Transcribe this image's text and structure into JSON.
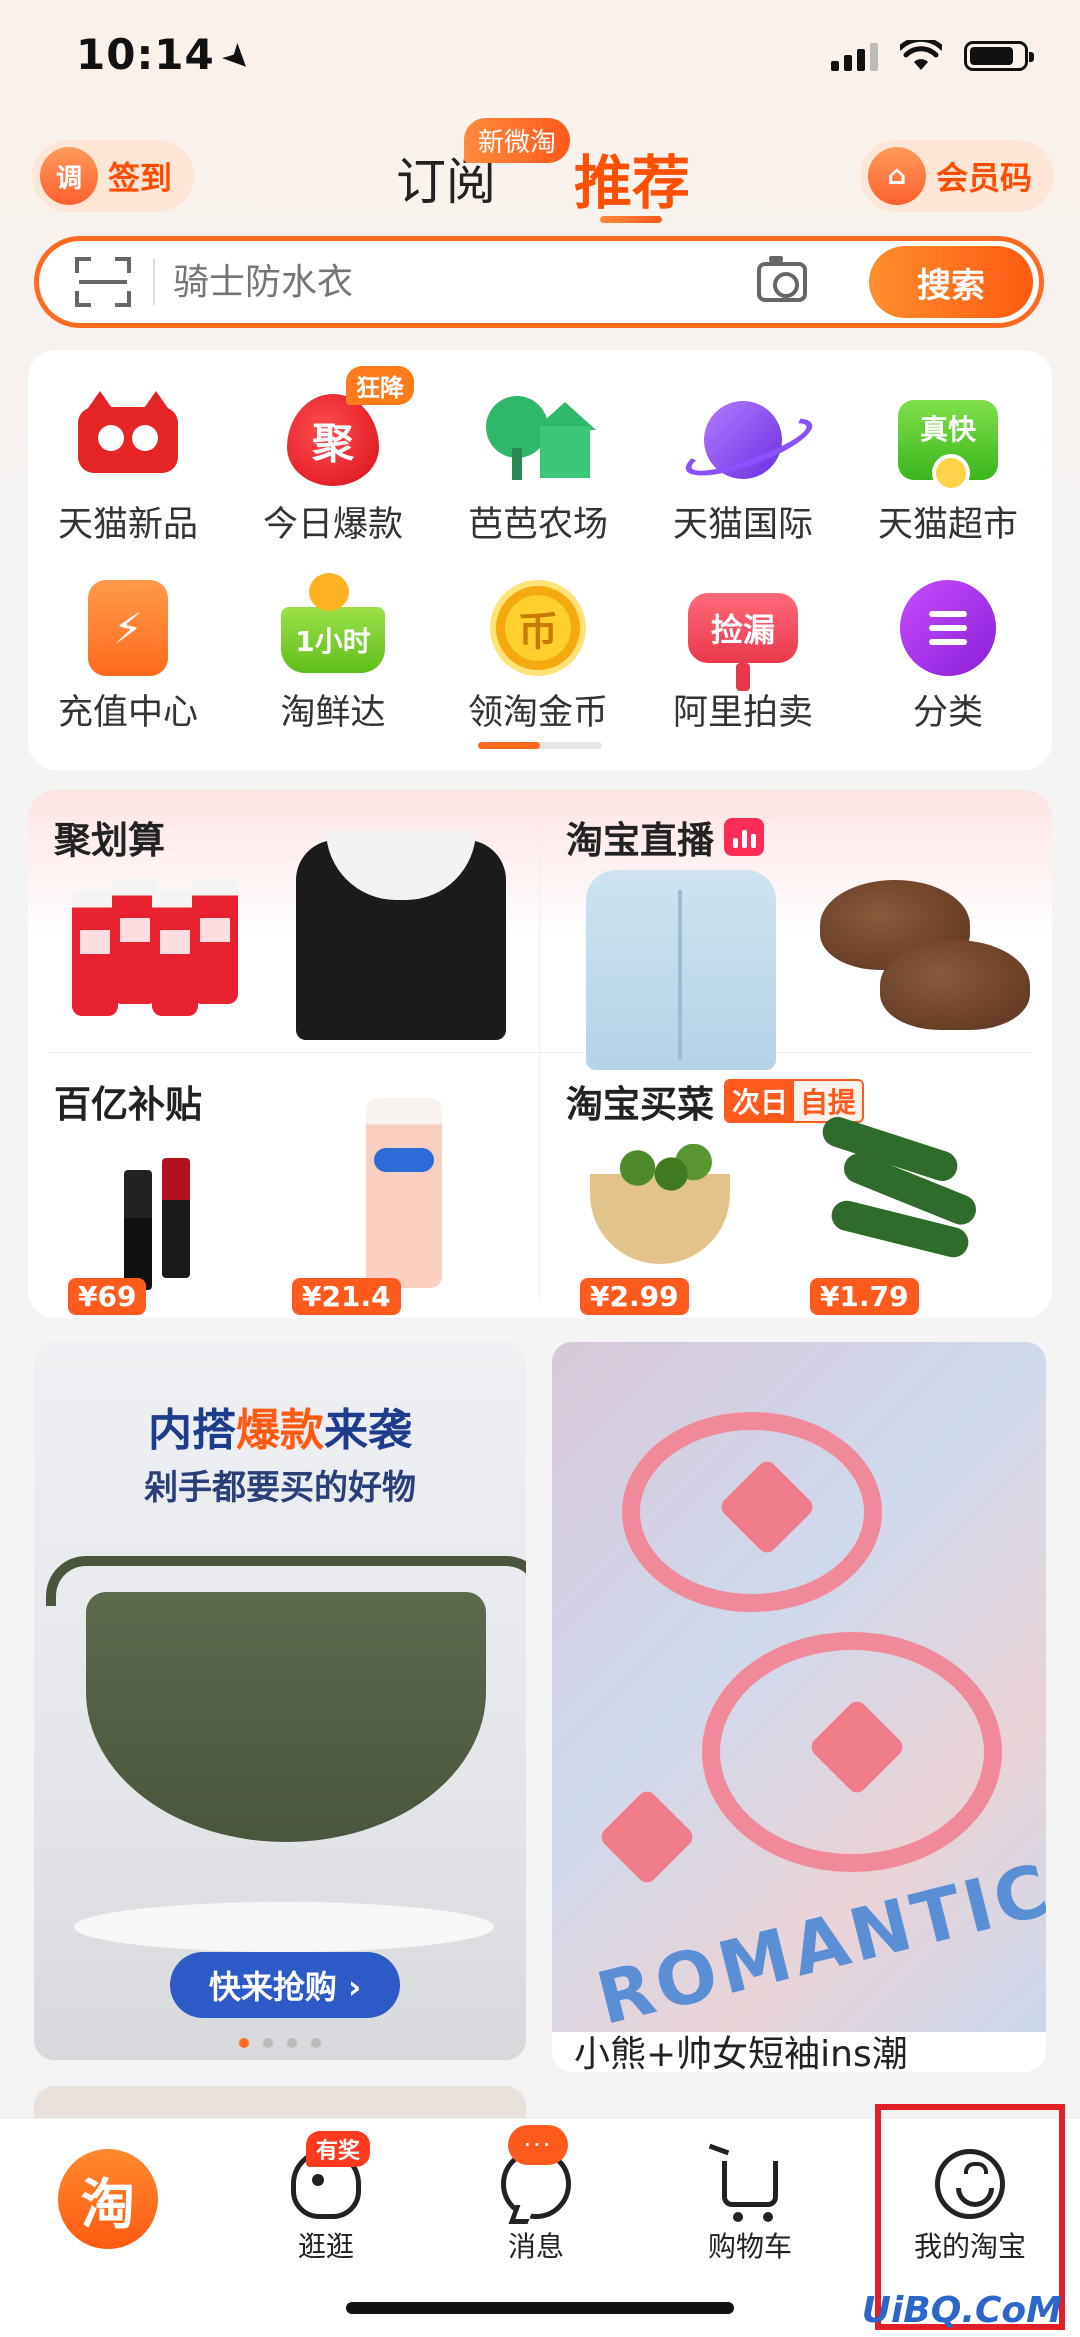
{
  "status": {
    "time": "10:14"
  },
  "header": {
    "checkin_label": "签到",
    "checkin_icon_text": "调",
    "tab_subscribe": "订阅",
    "tab_subscribe_badge": "新微淘",
    "tab_recommend": "推荐",
    "member_label": "会员码"
  },
  "search": {
    "placeholder": "骑士防水衣",
    "button": "搜索"
  },
  "categories": [
    {
      "label": "天猫新品",
      "icon": "tmall-new-icon"
    },
    {
      "label": "今日爆款",
      "icon": "hot-deal-icon",
      "icon_text": "聚",
      "badge": "狂降"
    },
    {
      "label": "芭芭农场",
      "icon": "farm-icon"
    },
    {
      "label": "天猫国际",
      "icon": "planet-icon"
    },
    {
      "label": "天猫超市",
      "icon": "supermarket-icon",
      "icon_text": "真快"
    },
    {
      "label": "充值中心",
      "icon": "recharge-icon",
      "icon_text": "⚡"
    },
    {
      "label": "淘鲜达",
      "icon": "basket-icon",
      "icon_text": "1小时"
    },
    {
      "label": "领淘金币",
      "icon": "coin-icon",
      "icon_text": "币"
    },
    {
      "label": "阿里拍卖",
      "icon": "auction-icon",
      "icon_text": "捡漏"
    },
    {
      "label": "分类",
      "icon": "menu-icon"
    }
  ],
  "promos": {
    "juhuasuan": {
      "title": "聚划算"
    },
    "live": {
      "title": "淘宝直播"
    },
    "subsidy": {
      "title": "百亿补贴",
      "price1": "¥69",
      "price2": "¥21.4"
    },
    "grocery": {
      "title": "淘宝买菜",
      "tag_a": "次日",
      "tag_b": "自提",
      "price1": "¥2.99",
      "price2": "¥1.79"
    }
  },
  "feed": {
    "left": {
      "headline_a": "内搭",
      "headline_hl": "爆款",
      "headline_b": "来袭",
      "sub": "剁手都要买的好物",
      "button": "快来抢购 ›"
    },
    "right": {
      "print_word": "ROMANTIC",
      "caption": "小熊+帅女短袖ins潮"
    }
  },
  "tabbar": {
    "home_icon_text": "淘",
    "stroll": "逛逛",
    "stroll_badge": "有奖",
    "messages": "消息",
    "messages_badge": "···",
    "cart": "购物车",
    "me": "我的淘宝"
  },
  "watermark": "UiBQ.CoM",
  "colors": {
    "brand": "#ff5000",
    "highlight": "#e21e26"
  }
}
